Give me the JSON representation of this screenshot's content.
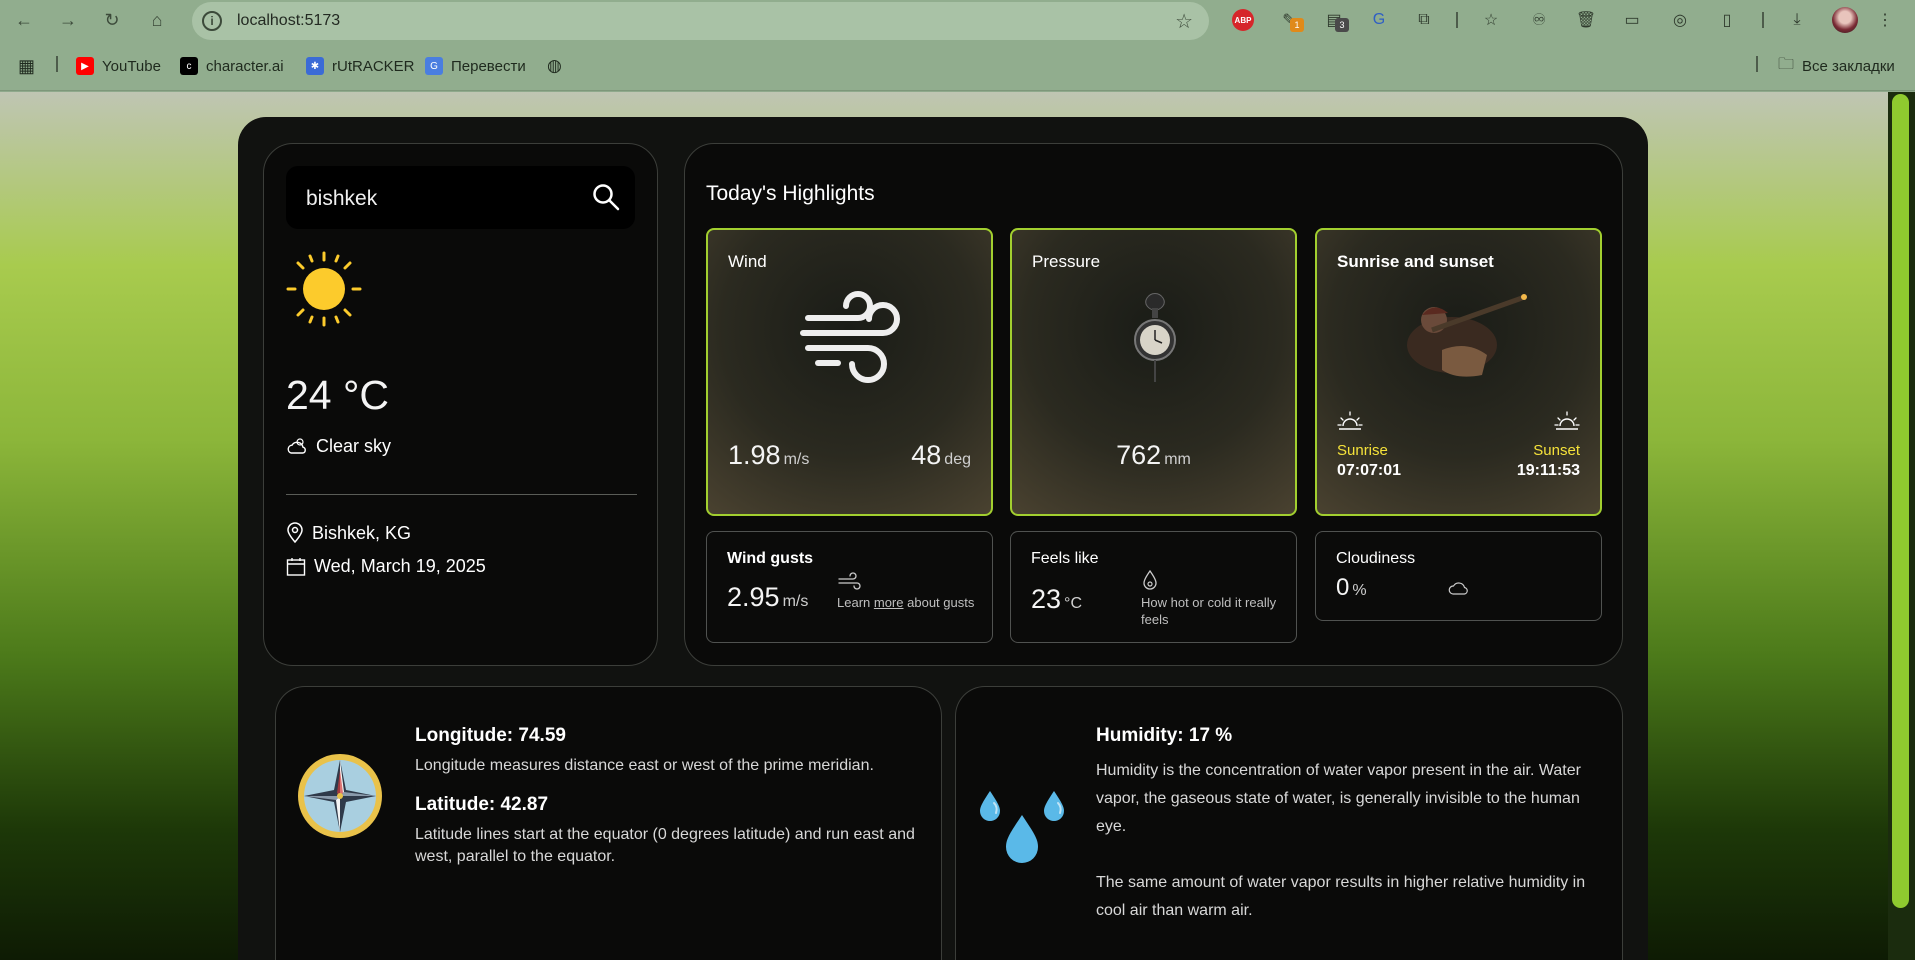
{
  "browser": {
    "url": "localhost:5173",
    "extensions": [
      {
        "name": "adblock-plus-icon",
        "label": "ABP"
      },
      {
        "name": "extension-1-icon",
        "badge": "1"
      },
      {
        "name": "extension-2-icon",
        "badge": "3"
      }
    ],
    "bookmarks": [
      {
        "label": "YouTube",
        "icon": "youtube-icon",
        "color": "#ff0000"
      },
      {
        "label": "character.ai",
        "icon": "character-ai-icon",
        "color": "#000000"
      },
      {
        "label": "rUtRACKER",
        "icon": "rutracker-icon",
        "color": "#3b6bd6"
      },
      {
        "label": "Перевести",
        "icon": "translate-icon",
        "color": "#4a7ee0"
      }
    ],
    "all_bookmarks_label": "Все закладки"
  },
  "search": {
    "value": "bishkek"
  },
  "current": {
    "temperature": "24 °C",
    "description": "Clear sky",
    "location": "Bishkek, KG",
    "date": "Wed, March 19, 2025"
  },
  "highlights": {
    "title": "Today's Highlights",
    "wind": {
      "label": "Wind",
      "speed": "1.98",
      "speed_unit": "m/s",
      "direction": "48",
      "direction_unit": "deg"
    },
    "pressure": {
      "label": "Pressure",
      "value": "762",
      "unit": "mm"
    },
    "sun": {
      "label": "Sunrise and sunset",
      "sunrise_label": "Sunrise",
      "sunrise": "07:07:01",
      "sunset_label": "Sunset",
      "sunset": "19:11:53"
    },
    "gusts": {
      "label": "Wind gusts",
      "value": "2.95",
      "unit": "m/s",
      "note_pre": "Learn",
      "note_link": "more",
      "note_post": "about gusts"
    },
    "feels": {
      "label": "Feels like",
      "value": "23",
      "unit": "°C",
      "note": "How hot or cold it really feels"
    },
    "cloudiness": {
      "label": "Cloudiness",
      "value": "0",
      "unit": "%"
    }
  },
  "coords": {
    "longitude_title": "Longitude: 74.59",
    "longitude_text": "Longitude measures distance east or west of the prime meridian.",
    "latitude_title": "Latitude: 42.87",
    "latitude_text": "Latitude lines start at the equator (0 degrees latitude) and run east and west, parallel to the equator."
  },
  "humidity": {
    "title": "Humidity: 17 %",
    "text1": "Humidity is the concentration of water vapor present in the air. Water vapor, the gaseous state of water, is generally invisible to the human eye.",
    "text2": "The same amount of water vapor results in higher relative humidity in cool air than warm air."
  },
  "colors": {
    "accent": "#a2cf2f",
    "sun_label": "#f5e23a"
  }
}
